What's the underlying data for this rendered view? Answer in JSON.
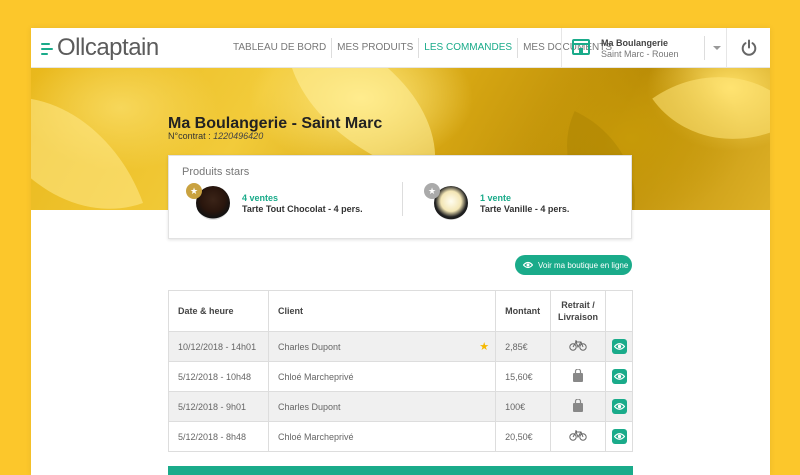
{
  "brand": {
    "logo_text": "Ollcaptain",
    "accent": "#1aab8a",
    "background": "#fcc72b"
  },
  "nav": {
    "items": [
      {
        "label": "TABLEAU DE BORD",
        "active": false
      },
      {
        "label": "MES PRODUITS",
        "active": false
      },
      {
        "label": "LES COMMANDES",
        "active": true
      },
      {
        "label": "MES DOCUMENTS",
        "active": false
      }
    ]
  },
  "shop_selector": {
    "name": "Ma Boulangerie",
    "city": "Saint Marc - Rouen",
    "icon": "store-icon"
  },
  "power": {
    "icon": "power-icon"
  },
  "hero": {
    "title": "Ma Boulangerie - Saint Marc",
    "contract_label": "N°contrat :",
    "contract_number": "1220496420"
  },
  "stars": {
    "title": "Produits stars",
    "products": [
      {
        "sales": "4 ventes",
        "name": "Tarte Tout Chocolat - 4 pers.",
        "badge_color": "#c9a240"
      },
      {
        "sales": "1 vente",
        "name": "Tarte Vanille - 4 pers.",
        "badge_color": "#aaaaaa"
      }
    ]
  },
  "boutique_button": {
    "label": "Voir ma boutique en ligne",
    "icon": "eye-icon"
  },
  "orders": {
    "headers": {
      "date": "Date & heure",
      "client": "Client",
      "amount": "Montant",
      "pickup_line1": "Retrait /",
      "pickup_line2": "Livraison"
    },
    "rows": [
      {
        "date": "10/12/2018 - 14h01",
        "client": "Charles Dupont",
        "starred": true,
        "amount": "2,85€",
        "mode": "bike-icon"
      },
      {
        "date": "5/12/2018 - 10h48",
        "client": "Chloé Marcheprivé",
        "starred": false,
        "amount": "15,60€",
        "mode": "bag-icon"
      },
      {
        "date": "5/12/2018 - 9h01",
        "client": "Charles Dupont",
        "starred": false,
        "amount": "100€",
        "mode": "bag-icon"
      },
      {
        "date": "5/12/2018 - 8h48",
        "client": "Chloé Marcheprivé",
        "starred": false,
        "amount": "20,50€",
        "mode": "bike-icon"
      }
    ]
  }
}
